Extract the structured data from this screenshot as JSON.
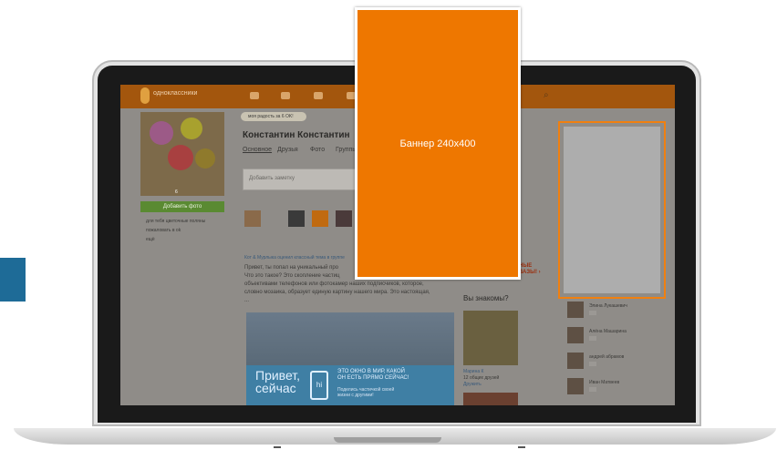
{
  "colors": {
    "banner": "#ee7700",
    "header": "#a3560d",
    "side_tab": "#1e6b97"
  },
  "site": {
    "logo": "одноклассники",
    "notice": "моя радость за 6 OK!"
  },
  "profile": {
    "name": "Константин Константин",
    "tabs": [
      "Основное",
      "Друзья",
      "Фото",
      "Группы"
    ],
    "photo_count": "6",
    "add_photo": "Добавить фото",
    "links": [
      "для тебя цветочные поляны",
      "пожаловать в ok",
      "ещё"
    ],
    "post_placeholder": "Добавить заметку",
    "feed_head": "Кот & Мурлыка оценил классный тема в группе",
    "feed_text": [
      "Привет, ты попал на уникальный про",
      "Что это такое? Это скопление частиц",
      "объективами телефонов или фотокамер наших подписчиков, которое,",
      "словно мозаика, образует единую картину нашего мира. Это настоящая,",
      "..."
    ],
    "promo_big": "Привет,\nсейчас",
    "promo_app": "hi",
    "promo_text1": "ЭТО ОКНО В МИР, КАКОЙ\nОН ЕСТЬ ПРЯМО СЕЙЧАС!",
    "promo_text2": "Поделись частичкой своей\nжизни с другими!"
  },
  "suggest": {
    "title": "Вы знакомы?",
    "card_name": "Марина К",
    "card_sub": "12 общих друзей",
    "card_btn": "Дружить",
    "promo_label": "...НЫЕ\n...ВАЗЫ! ›"
  },
  "friends_list": [
    "Элина Лукашевич",
    "Алёна Машарина",
    "андрей абрамов",
    "Иван Матвеев"
  ],
  "banner": {
    "center_label": "Баннер 240x400"
  }
}
